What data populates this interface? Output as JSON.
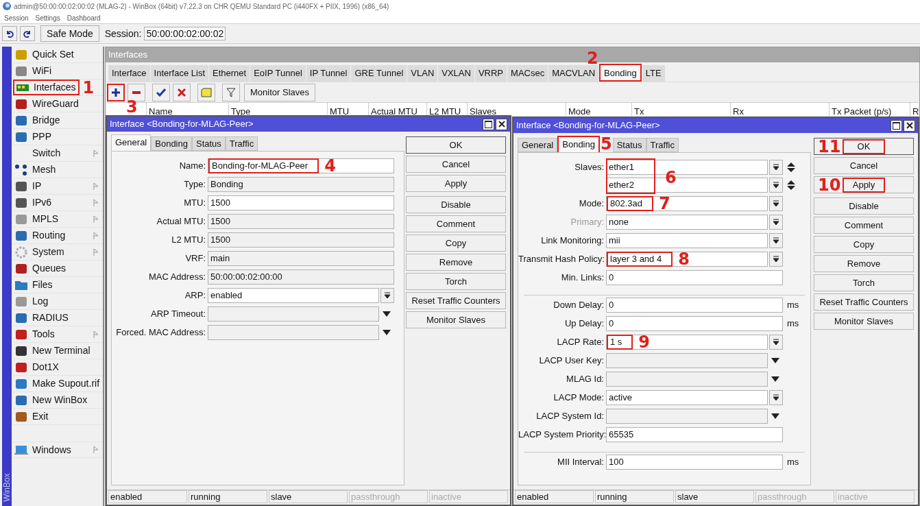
{
  "title_bar": {
    "title": "admin@50:00:00:02:00:02 (MLAG-2) - WinBox (64bit) v7.22.3 on CHR QEMU Standard PC (i440FX + PIIX, 1996) (x86_64)"
  },
  "menu": [
    "Session",
    "Settings",
    "Dashboard"
  ],
  "toolbar": {
    "safe_mode": "Safe Mode",
    "session_label": "Session:",
    "session_value": "50:00:00:02:00:02"
  },
  "sidebar": {
    "brand": "WinBox",
    "items": [
      {
        "label": "Quick Set",
        "submenu": false
      },
      {
        "label": "WiFi",
        "submenu": false
      },
      {
        "label": "Interfaces",
        "submenu": false,
        "callout": "1"
      },
      {
        "label": "WireGuard",
        "submenu": false
      },
      {
        "label": "Bridge",
        "submenu": false
      },
      {
        "label": "PPP",
        "submenu": false
      },
      {
        "label": "Switch",
        "submenu": true
      },
      {
        "label": "Mesh",
        "submenu": false
      },
      {
        "label": "IP",
        "submenu": true
      },
      {
        "label": "IPv6",
        "submenu": true
      },
      {
        "label": "MPLS",
        "submenu": true
      },
      {
        "label": "Routing",
        "submenu": true
      },
      {
        "label": "System",
        "submenu": true
      },
      {
        "label": "Queues",
        "submenu": false
      },
      {
        "label": "Files",
        "submenu": false
      },
      {
        "label": "Log",
        "submenu": false
      },
      {
        "label": "RADIUS",
        "submenu": false
      },
      {
        "label": "Tools",
        "submenu": true
      },
      {
        "label": "New Terminal",
        "submenu": false
      },
      {
        "label": "Dot1X",
        "submenu": false
      },
      {
        "label": "Make Supout.rif",
        "submenu": false
      },
      {
        "label": "New WinBox",
        "submenu": false
      },
      {
        "label": "Exit",
        "submenu": false
      }
    ],
    "bottom_items": [
      {
        "label": "Windows",
        "submenu": true
      }
    ]
  },
  "interfaces_window": {
    "title": "Interfaces",
    "tabs": [
      {
        "label": "Interface",
        "selected": false
      },
      {
        "label": "Interface List",
        "selected": false
      },
      {
        "label": "Ethernet",
        "selected": false
      },
      {
        "label": "EoIP Tunnel",
        "selected": false
      },
      {
        "label": "IP Tunnel",
        "selected": false
      },
      {
        "label": "GRE Tunnel",
        "selected": false
      },
      {
        "label": "VLAN",
        "selected": false
      },
      {
        "label": "VXLAN",
        "selected": false
      },
      {
        "label": "VRRP",
        "selected": false
      },
      {
        "label": "MACsec",
        "selected": false
      },
      {
        "label": "MACVLAN",
        "selected": false
      },
      {
        "label": "Bonding",
        "selected": true,
        "callout": "2"
      },
      {
        "label": "LTE",
        "selected": false
      }
    ],
    "add_callout": "3",
    "monitor_button": "Monitor Slaves",
    "columns": [
      "Name",
      "Type",
      "MTU",
      "Actual MTU",
      "L2 MTU",
      "Slaves",
      "Mode",
      "Tx",
      "Rx",
      "Tx Packet (p/s)",
      "R"
    ]
  },
  "general_dialog": {
    "title": "Interface <Bonding-for-MLAG-Peer>",
    "tabs": [
      {
        "label": "General",
        "selected": true
      },
      {
        "label": "Bonding",
        "selected": false
      },
      {
        "label": "Status",
        "selected": false
      },
      {
        "label": "Traffic",
        "selected": false
      }
    ],
    "fields": [
      {
        "kind": "edit",
        "label": "Name:",
        "value": "Bonding-for-MLAG-Peer",
        "callout": "4"
      },
      {
        "kind": "readonly",
        "label": "Type:",
        "value": "Bonding"
      },
      {
        "kind": "edit",
        "label": "MTU:",
        "value": "1500"
      },
      {
        "kind": "readonly",
        "label": "Actual MTU:",
        "value": "1500"
      },
      {
        "kind": "readonly",
        "label": "L2 MTU:",
        "value": "1500"
      },
      {
        "kind": "readonly",
        "label": "VRF:",
        "value": "main"
      },
      {
        "kind": "readonly",
        "label": "MAC Address:",
        "value": "50:00:00:02:00:00"
      },
      {
        "kind": "dropdown",
        "label": "ARP:",
        "value": "enabled"
      },
      {
        "kind": "empty-dropdown",
        "label": "ARP Timeout:"
      },
      {
        "kind": "empty-dropdown",
        "label": "Forced. MAC Address:"
      }
    ],
    "buttons": [
      {
        "label": "OK"
      },
      {
        "label": "Cancel"
      },
      {
        "label": "Apply"
      },
      {
        "label": "Disable"
      },
      {
        "label": "Comment"
      },
      {
        "label": "Copy"
      },
      {
        "label": "Remove"
      },
      {
        "label": "Torch"
      },
      {
        "label": "Reset Traffic Counters"
      },
      {
        "label": "Monitor Slaves"
      }
    ],
    "status": [
      {
        "label": "enabled",
        "disabled": false
      },
      {
        "label": "running",
        "disabled": false
      },
      {
        "label": "slave",
        "disabled": false
      },
      {
        "label": "passthrough",
        "disabled": true
      },
      {
        "label": "inactive",
        "disabled": true
      }
    ]
  },
  "bonding_dialog": {
    "title": "Interface <Bonding-for-MLAG-Peer>",
    "tabs": [
      {
        "label": "General",
        "selected": false
      },
      {
        "label": "Bonding",
        "selected": true,
        "callout": "5"
      },
      {
        "label": "Status",
        "selected": false
      },
      {
        "label": "Traffic",
        "selected": false
      }
    ],
    "fields": [
      {
        "kind": "multi",
        "label": "Slaves:",
        "values": [
          "ether1",
          "ether2"
        ],
        "callout": "6",
        "disabled": false
      },
      {
        "kind": "dropdown",
        "label": "Mode:",
        "value": "802.3ad",
        "callout": "7",
        "disabled": false
      },
      {
        "kind": "dropdown",
        "label": "Primary:",
        "value": "none",
        "disabled": true
      },
      {
        "kind": "dropdown",
        "label": "Link Monitoring:",
        "value": "mii",
        "disabled": false
      },
      {
        "kind": "dropdown",
        "label": "Transmit Hash Policy:",
        "value": "layer 3 and 4",
        "callout": "8",
        "disabled": false
      },
      {
        "kind": "edit",
        "label": "Min. Links:",
        "value": "0",
        "disabled": false
      },
      {
        "kind": "separator"
      },
      {
        "kind": "edit",
        "label": "Down Delay:",
        "value": "0",
        "unit": "ms",
        "disabled": false
      },
      {
        "kind": "edit",
        "label": "Up Delay:",
        "value": "0",
        "unit": "ms",
        "disabled": false
      },
      {
        "kind": "dropdown",
        "label": "LACP Rate:",
        "value": "1 s",
        "callout": "9",
        "disabled": false
      },
      {
        "kind": "empty-dropdown",
        "label": "LACP User Key:",
        "disabled": false
      },
      {
        "kind": "empty-dropdown",
        "label": "MLAG Id:",
        "disabled": false
      },
      {
        "kind": "dropdown",
        "label": "LACP Mode:",
        "value": "active",
        "disabled": false
      },
      {
        "kind": "empty-dropdown",
        "label": "LACP System Id:",
        "disabled": false
      },
      {
        "kind": "edit",
        "label": "LACP System Priority:",
        "value": "65535",
        "disabled": false
      },
      {
        "kind": "separator"
      },
      {
        "kind": "edit",
        "label": "MII Interval:",
        "value": "100",
        "unit": "ms",
        "disabled": false
      }
    ],
    "buttons": [
      {
        "label": "OK",
        "callout": "11"
      },
      {
        "label": "Cancel"
      },
      {
        "label": "Apply",
        "callout": "10"
      },
      {
        "label": "Disable"
      },
      {
        "label": "Comment"
      },
      {
        "label": "Copy"
      },
      {
        "label": "Remove"
      },
      {
        "label": "Torch"
      },
      {
        "label": "Reset Traffic Counters"
      },
      {
        "label": "Monitor Slaves"
      }
    ],
    "status": [
      {
        "label": "enabled",
        "disabled": false
      },
      {
        "label": "running",
        "disabled": false
      },
      {
        "label": "slave",
        "disabled": false
      },
      {
        "label": "passthrough",
        "disabled": true
      },
      {
        "label": "inactive",
        "disabled": true
      }
    ]
  }
}
